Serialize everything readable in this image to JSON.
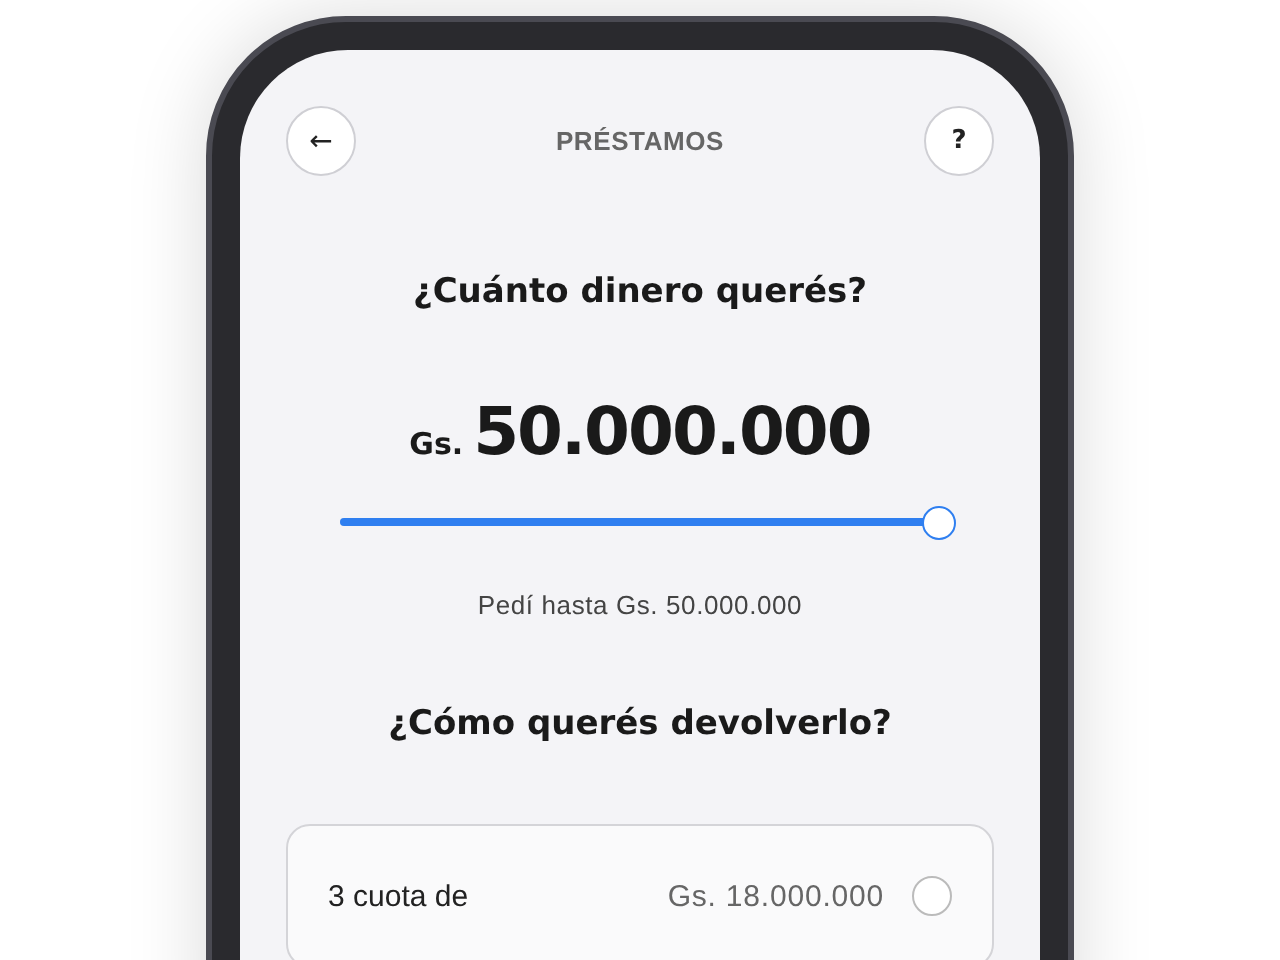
{
  "header": {
    "back_icon": "←",
    "title": "PRÉSTAMOS",
    "help": "?"
  },
  "amount_question": "¿Cuánto dinero querés?",
  "amount": {
    "currency": "Gs.",
    "value": "50.000.000"
  },
  "slider": {
    "level": 1
  },
  "limit_text": "Pedí hasta Gs. 50.000.000",
  "repay_question": "¿Cómo querés devolverlo?",
  "options": [
    {
      "label": "3 cuota de",
      "amount": "Gs. 18.000.000",
      "selected": false
    }
  ]
}
